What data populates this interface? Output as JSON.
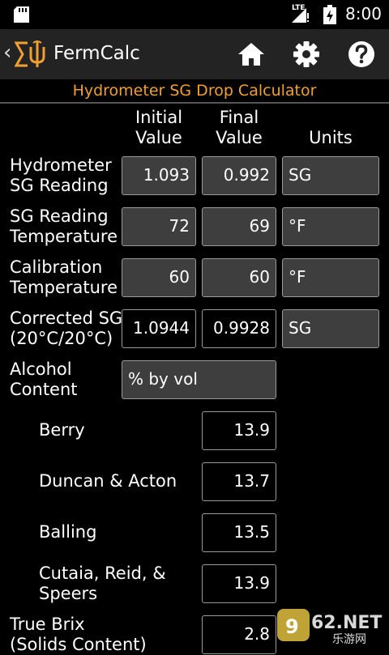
{
  "status": {
    "network": "LTE",
    "time": "8:00"
  },
  "app": {
    "title": "FermCalc"
  },
  "page": {
    "heading": "Hydrometer SG Drop Calculator"
  },
  "columns": {
    "initial": [
      "Initial",
      "Value"
    ],
    "final": [
      "Final",
      "Value"
    ],
    "units": "Units"
  },
  "rows": {
    "hydrometer": {
      "label": [
        "Hydrometer",
        "SG Reading"
      ],
      "initial": "1.093",
      "final": "0.992",
      "units": "SG"
    },
    "sgtemp": {
      "label": [
        "SG Reading",
        "Temperature"
      ],
      "initial": "72",
      "final": "69",
      "units": "°F"
    },
    "caltemp": {
      "label": [
        "Calibration",
        "Temperature"
      ],
      "initial": "60",
      "final": "60",
      "units": "°F"
    },
    "corrected": {
      "label": [
        "Corrected SG",
        "(20°C/20°C)"
      ],
      "initial": "1.0944",
      "final": "0.9928",
      "units": "SG"
    }
  },
  "alcohol": {
    "label": [
      "Alcohol",
      "Content"
    ],
    "unit_select": "% by vol",
    "formulas": [
      {
        "label": [
          "Berry"
        ],
        "value": "13.9"
      },
      {
        "label": [
          "Duncan & Acton"
        ],
        "value": "13.7"
      },
      {
        "label": [
          "Balling"
        ],
        "value": "13.5"
      },
      {
        "label": [
          "Cutaia, Reid, &",
          "Speers"
        ],
        "value": "13.9"
      }
    ]
  },
  "brix": {
    "label": [
      "True Brix",
      "(Solids Content)"
    ],
    "value": "2.8"
  },
  "watermark": {
    "text": "962.NET",
    "subtext": "乐游网"
  }
}
